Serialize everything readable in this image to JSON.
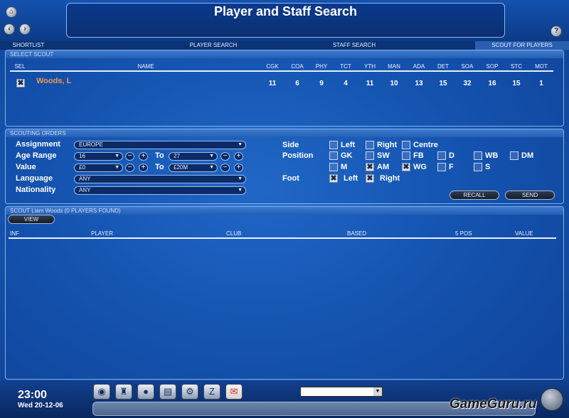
{
  "header": {
    "title": "Player and Staff Search",
    "home_icon": "home-icon",
    "back_icon": "back-arrow-icon",
    "forward_icon": "forward-arrow-icon",
    "help_label": "?"
  },
  "tabs": [
    "SHORTLIST",
    "PLAYER SEARCH",
    "STAFF SEARCH",
    "SCOUT FOR PLAYERS"
  ],
  "select_scout": {
    "header": "SELECT SCOUT",
    "columns": [
      "SEL",
      "NAME",
      "CGK",
      "COA",
      "PHY",
      "TCT",
      "YTH",
      "MAN",
      "ADA",
      "DET",
      "SOA",
      "SOP",
      "STC",
      "MOT"
    ],
    "rows": [
      {
        "selected": "✖",
        "name": "Woods, L",
        "values": [
          "11",
          "6",
          "9",
          "4",
          "11",
          "10",
          "13",
          "15",
          "32",
          "16",
          "15",
          "1"
        ]
      }
    ]
  },
  "orders": {
    "header": "SCOUTING ORDERS",
    "labels": {
      "assignment": "Assignment",
      "age": "Age Range",
      "value": "Value",
      "language": "Language",
      "nationality": "Nationality",
      "to": "To"
    },
    "assignment": "EUROPE",
    "age_from": "16",
    "age_to": "27",
    "value_from": "£0",
    "value_to": "£20M",
    "language": "ANY",
    "nationality": "ANY",
    "minus": "−",
    "plus": "+",
    "side_label": "Side",
    "position_label": "Position",
    "foot_label": "Foot",
    "side_options": [
      {
        "label": "Left",
        "checked": false
      },
      {
        "label": "Right",
        "checked": false
      },
      {
        "label": "Centre",
        "checked": false
      }
    ],
    "position_row1": [
      {
        "label": "GK",
        "checked": false
      },
      {
        "label": "SW",
        "checked": false
      },
      {
        "label": "FB",
        "checked": false
      },
      {
        "label": "D",
        "checked": false
      },
      {
        "label": "WB",
        "checked": false
      },
      {
        "label": "DM",
        "checked": false
      }
    ],
    "position_row2": [
      {
        "label": "M",
        "checked": false
      },
      {
        "label": "AM",
        "checked": true
      },
      {
        "label": "WG",
        "checked": true
      },
      {
        "label": "F",
        "checked": false
      },
      {
        "label": "S",
        "checked": false
      }
    ],
    "foot_options": [
      {
        "label": "Left",
        "checked": true
      },
      {
        "label": "Right",
        "checked": true
      }
    ],
    "recall": "RECALL",
    "send": "SEND"
  },
  "results": {
    "header": "SCOUT Liam Woods (0 PLAYERS FOUND)",
    "view": "VIEW",
    "columns": [
      "INF",
      "PLAYER",
      "CLUB",
      "BASED",
      "5 POS",
      "VALUE"
    ]
  },
  "footer": {
    "time": "23:00",
    "date": "Wed 20-12-06",
    "icons": [
      "helmet-icon",
      "trophy-icon",
      "globe-icon",
      "news-icon",
      "settings-icon",
      "zip-icon",
      "mail-icon"
    ],
    "watermark": "GameGuru.ru"
  },
  "colors": {
    "accent_orange": "#f09a4a",
    "text_white": "#ffffff"
  }
}
